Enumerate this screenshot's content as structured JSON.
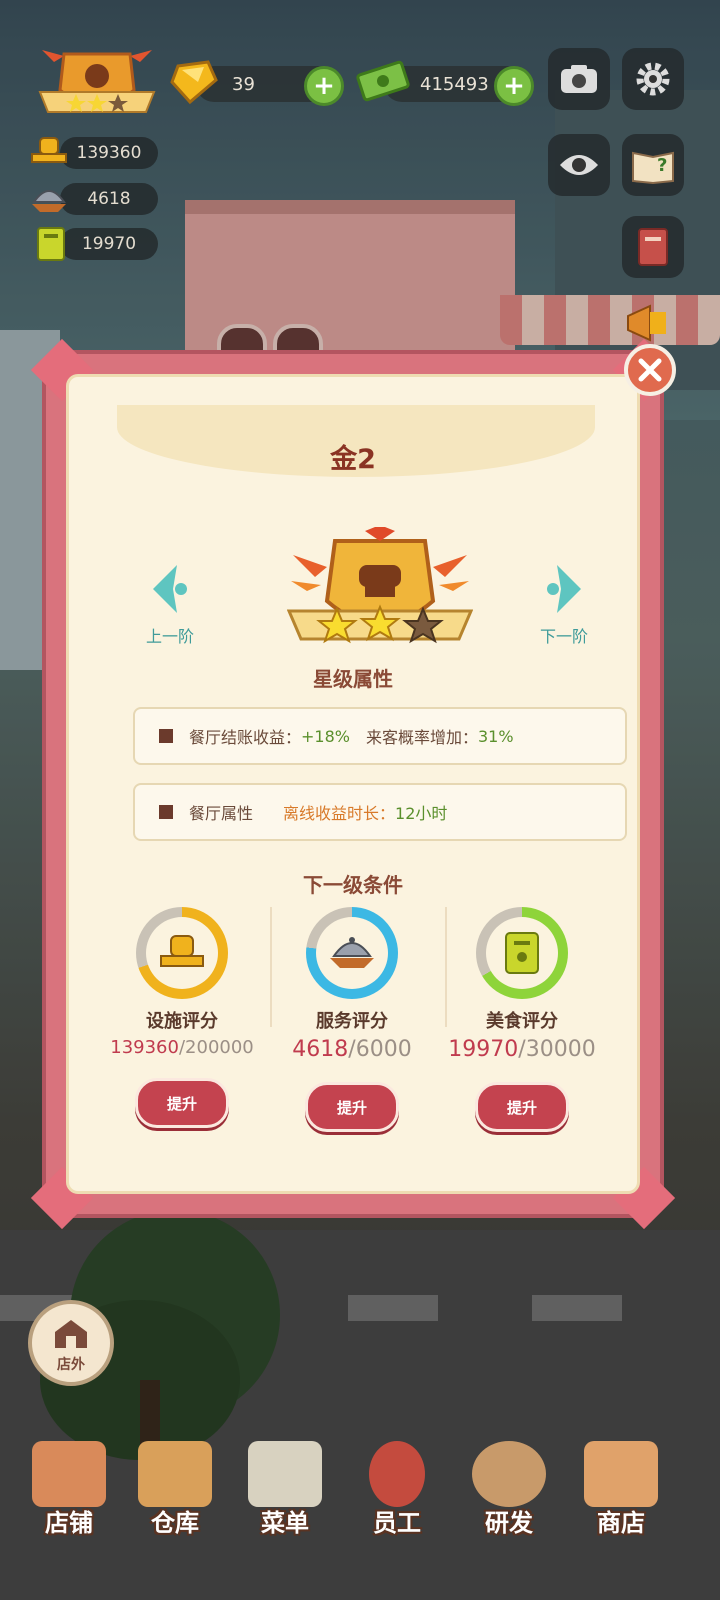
{
  "hud": {
    "gems": "39",
    "cash": "415493",
    "facility_score": "139360",
    "service_score": "4618",
    "food_score": "19970"
  },
  "dialog": {
    "title": "金2",
    "prev_label": "上一阶",
    "next_label": "下一阶",
    "stars_filled": 2,
    "stars_total": 3,
    "section_star_attrs": "星级属性",
    "attr1": {
      "label": "餐厅结账收益：",
      "value1": "+18%",
      "label2": "来客概率增加：",
      "value2": "31%"
    },
    "attr2": {
      "label": "餐厅属性",
      "label2": "离线收益时长：",
      "value2": "12小时"
    },
    "section_next_level": "下一级条件",
    "requirements": [
      {
        "name": "设施评分",
        "current": "139360",
        "target": "/200000",
        "progress": 0.697,
        "ring_color": "#f0b21d",
        "icon": "chef-hat-icon",
        "button": "提升"
      },
      {
        "name": "服务评分",
        "current": "4618",
        "target": "/6000",
        "progress": 0.77,
        "ring_color": "#3cb8e4",
        "icon": "cloche-icon",
        "button": "提升"
      },
      {
        "name": "美食评分",
        "current": "19970",
        "target": "/30000",
        "progress": 0.666,
        "ring_color": "#8ed43a",
        "icon": "recipe-book-icon",
        "button": "提升"
      }
    ]
  },
  "outside_label": "店外",
  "bottom_nav": [
    "店铺",
    "仓库",
    "菜单",
    "员工",
    "研发",
    "商店"
  ]
}
